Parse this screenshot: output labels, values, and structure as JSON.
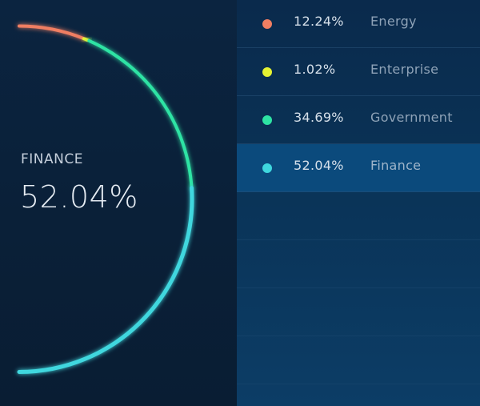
{
  "colors": {
    "energy": "#f07e62",
    "enterprise": "#e5f232",
    "government": "#2ee3a4",
    "finance": "#3fd7de"
  },
  "selected": {
    "label": "FINANCE",
    "value": "52.04%"
  },
  "legend": [
    {
      "pct": "12.24%",
      "name": "Energy",
      "color": "#f07e62"
    },
    {
      "pct": "1.02%",
      "name": "Enterprise",
      "color": "#e5f232"
    },
    {
      "pct": "34.69%",
      "name": "Government",
      "color": "#2ee3a4"
    },
    {
      "pct": "52.04%",
      "name": "Finance",
      "color": "#3fd7de"
    }
  ],
  "chart_data": {
    "type": "pie",
    "style": "half-donut arc",
    "categories": [
      "Energy",
      "Enterprise",
      "Government",
      "Finance"
    ],
    "values": [
      12.24,
      1.02,
      34.69,
      52.04
    ],
    "colors": [
      "#f07e62",
      "#e5f232",
      "#2ee3a4",
      "#3fd7de"
    ],
    "selected": "Finance"
  }
}
